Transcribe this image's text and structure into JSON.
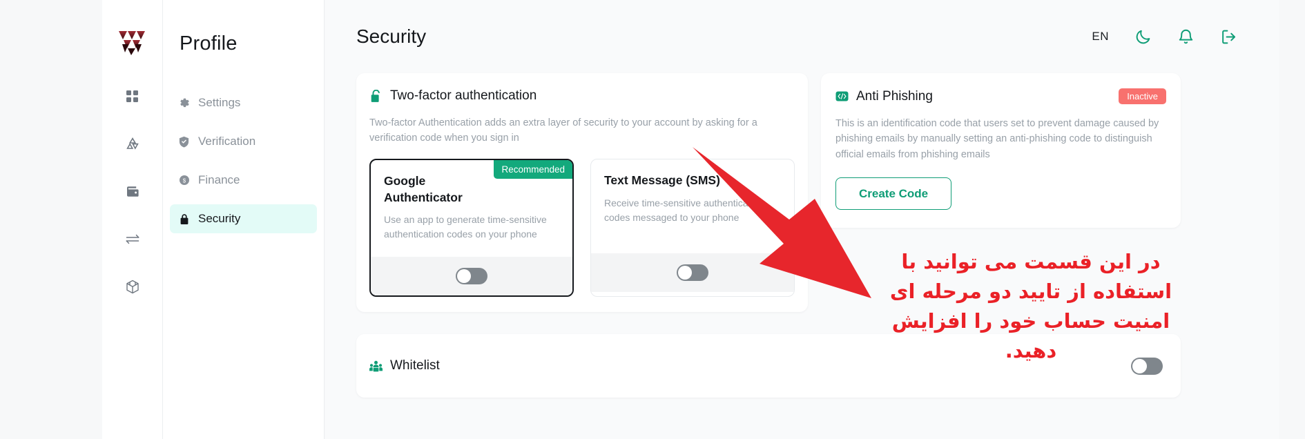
{
  "brand": {
    "logo_alt": "logo",
    "logo_color": "#8e1f27"
  },
  "rail": {
    "items": [
      {
        "name": "dashboard",
        "icon": "grid-icon"
      },
      {
        "name": "trade",
        "icon": "triangle-cycle-icon"
      },
      {
        "name": "wallet",
        "icon": "wallet-icon"
      },
      {
        "name": "transfer",
        "icon": "exchange-arrows-icon"
      },
      {
        "name": "box",
        "icon": "cube-icon"
      }
    ]
  },
  "sidebar": {
    "title": "Profile",
    "items": [
      {
        "label": "Settings",
        "icon": "gear-icon",
        "active": false
      },
      {
        "label": "Verification",
        "icon": "shield-icon",
        "active": false
      },
      {
        "label": "Finance",
        "icon": "dollar-coin-icon",
        "active": false
      },
      {
        "label": "Security",
        "icon": "lock-icon",
        "active": true
      }
    ]
  },
  "topbar": {
    "title": "Security",
    "language": "EN",
    "icons": [
      {
        "name": "moon-icon"
      },
      {
        "name": "bell-icon"
      },
      {
        "name": "logout-icon"
      }
    ],
    "accent": "#0f9d76"
  },
  "two_factor": {
    "icon": "lock-open-icon",
    "title": "Two-factor authentication",
    "description": "Two-factor Authentication adds an extra layer of security to your account by asking for a verification code when you sign in",
    "options": [
      {
        "title": "Google Authenticator",
        "description": "Use an app to generate time-sensitive authentication codes on your phone",
        "badge": "Recommended",
        "badge_color": "#13a97c",
        "selected": true,
        "toggle_on": false
      },
      {
        "title": "Text Message (SMS)",
        "description": "Receive time-sensitive authentication codes messaged to your phone",
        "badge": "",
        "selected": false,
        "toggle_on": false
      }
    ]
  },
  "anti_phishing": {
    "icon": "code-badge-icon",
    "title": "Anti Phishing",
    "status": "Inactive",
    "status_color": "#f8716e",
    "description": "This is an identification code that users set to prevent damage caused by phishing emails by manually setting an anti-phishing code to distinguish official emails from phishing emails",
    "button_label": "Create Code"
  },
  "whitelist": {
    "icon": "users-group-icon",
    "title": "Whitelist",
    "toggle_on": false
  },
  "annotation": {
    "text": "در این قسمت می توانید با استفاده از تایید دو مرحله ای امنیت حساب خود را افزایش دهید.",
    "color": "#ea2127",
    "arrow": "red-arrow-pointing-up-left"
  }
}
